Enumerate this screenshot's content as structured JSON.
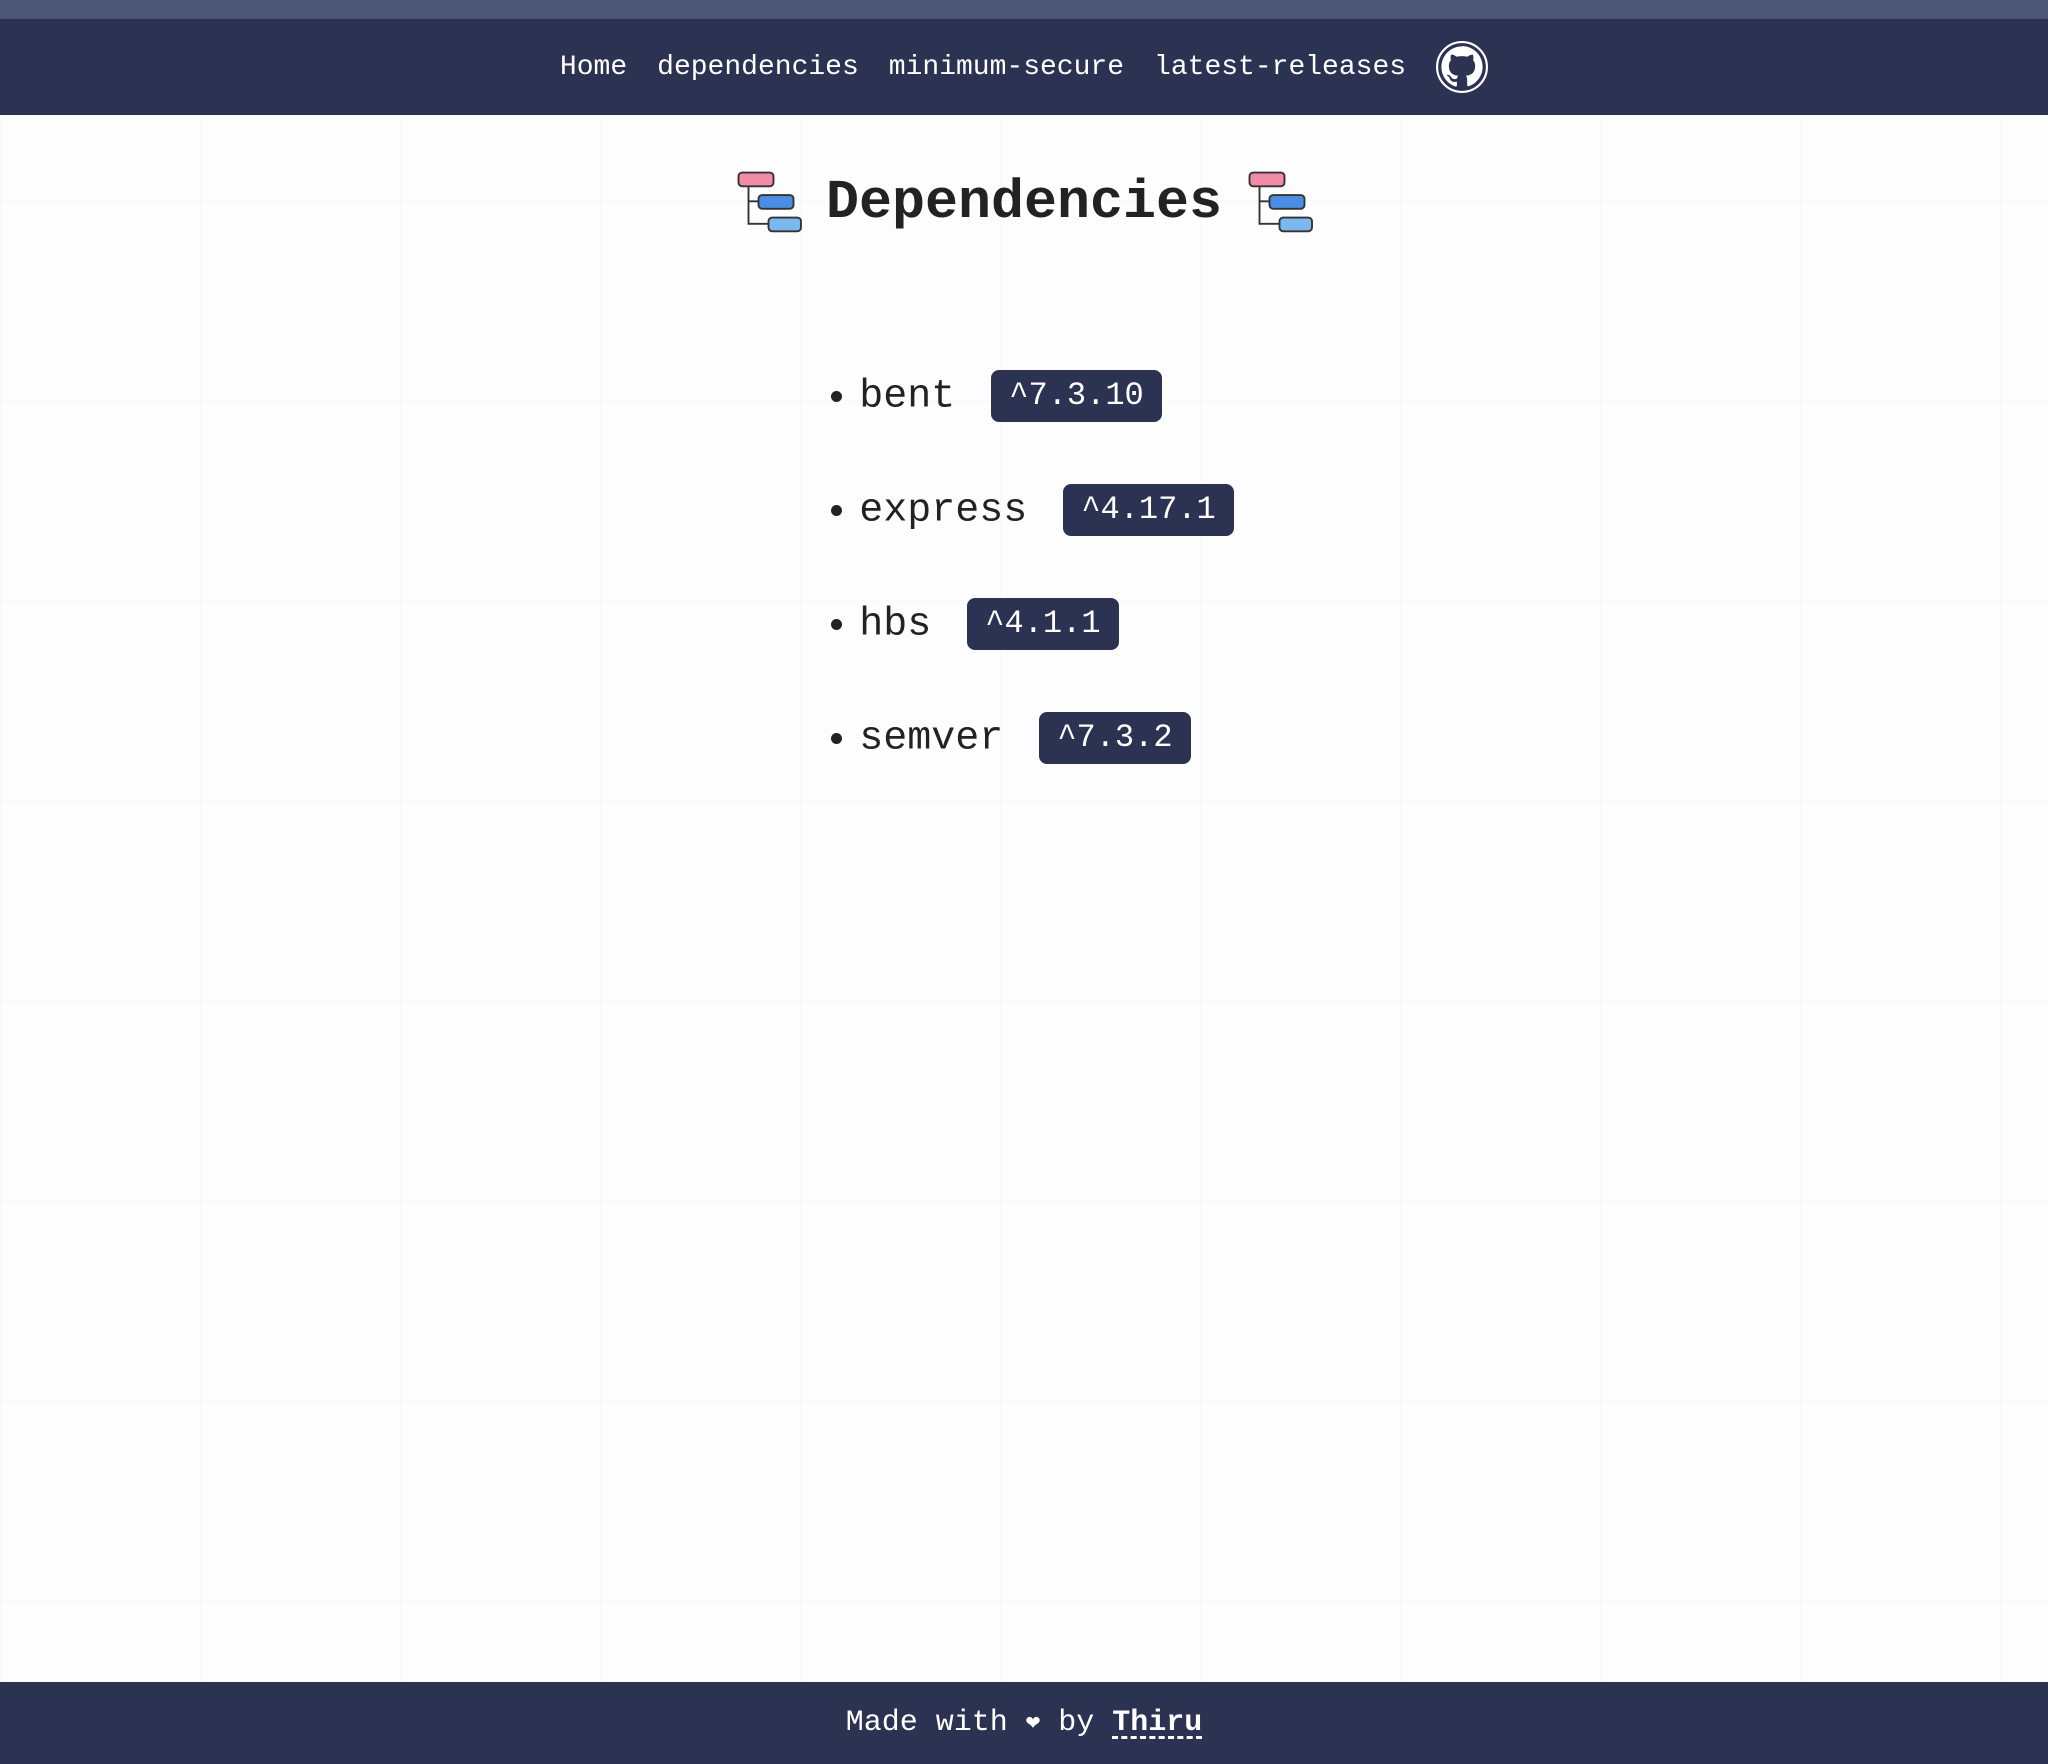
{
  "nav": {
    "items": [
      {
        "label": "Home"
      },
      {
        "label": "dependencies"
      },
      {
        "label": "minimum-secure"
      },
      {
        "label": "latest-releases"
      }
    ]
  },
  "page": {
    "title": "Dependencies"
  },
  "dependencies": [
    {
      "name": "bent",
      "version": "^7.3.10"
    },
    {
      "name": "express",
      "version": "^4.17.1"
    },
    {
      "name": "hbs",
      "version": "^4.1.1"
    },
    {
      "name": "semver",
      "version": "^7.3.2"
    }
  ],
  "footer": {
    "prefix": "Made with ",
    "heart": "❤",
    "by": " by ",
    "author": "Thiru"
  }
}
